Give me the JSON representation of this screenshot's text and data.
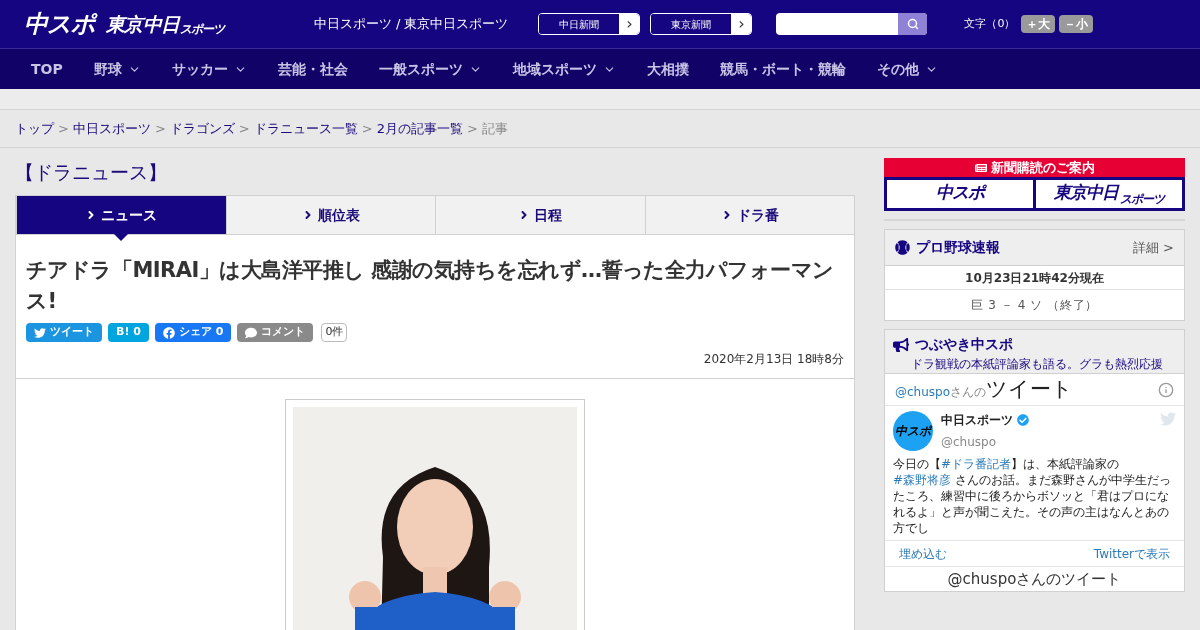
{
  "header": {
    "logo_main": "中スポ",
    "logo_tokyo": "東京中日",
    "logo_tokyo_small": "スポーツ",
    "site_title": "中日スポーツ / 東京中日スポーツ",
    "paper_links": [
      {
        "label": "中日新聞",
        "arrow": "›"
      },
      {
        "label": "東京新聞",
        "arrow": "›"
      }
    ],
    "font_size_label": "文字（0）",
    "font_buttons": [
      "＋大",
      "－小"
    ]
  },
  "nav": [
    {
      "label": "TOP",
      "has_menu": false
    },
    {
      "label": "野球",
      "has_menu": true
    },
    {
      "label": "サッカー",
      "has_menu": true
    },
    {
      "label": "芸能・社会",
      "has_menu": false
    },
    {
      "label": "一般スポーツ",
      "has_menu": true
    },
    {
      "label": "地域スポーツ",
      "has_menu": true
    },
    {
      "label": "大相撲",
      "has_menu": false
    },
    {
      "label": "競馬・ボート・競輪",
      "has_menu": false
    },
    {
      "label": "その他",
      "has_menu": true
    }
  ],
  "breadcrumb": [
    {
      "label": "トップ",
      "link": true
    },
    {
      "label": "中日スポーツ",
      "link": true
    },
    {
      "label": "ドラゴンズ",
      "link": true
    },
    {
      "label": "ドラニュース一覧",
      "link": true
    },
    {
      "label": "2月の記事一覧",
      "link": true
    },
    {
      "label": "記事",
      "link": false
    }
  ],
  "breadcrumb_separator": ">",
  "section_title": "【ドラニュース】",
  "tabs": [
    {
      "label": "ニュース",
      "selected": true
    },
    {
      "label": "順位表",
      "selected": false
    },
    {
      "label": "日程",
      "selected": false
    },
    {
      "label": "ドラ番",
      "selected": false
    }
  ],
  "article": {
    "headline": "チアドラ「MIRAI」は大島洋平推し 感謝の気持ちを忘れず…誓った全力パフォーマンス!",
    "share_buttons": [
      {
        "kind": "twitter",
        "label": "ツイート"
      },
      {
        "kind": "hatena",
        "label": "B! 0"
      },
      {
        "kind": "facebook",
        "label": "シェア 0"
      },
      {
        "kind": "comment",
        "label": "コメント"
      }
    ],
    "comment_count": "0件",
    "date": "2020年2月13日 18時8分"
  },
  "sidebar": {
    "subscribe": {
      "title": "新聞購読のご案内",
      "logos": [
        "中スポ",
        "東京中日"
      ],
      "logo_small": "スポーツ"
    },
    "baseball": {
      "title": "プロ野球速報",
      "detail_link": "詳細 >",
      "updated": "10月23日21時42分現在",
      "score": "巨 3 － 4 ソ （終了）"
    },
    "tweets": {
      "title": "つぶやき中スポ",
      "subtitle": "ドラ観戦の本紙評論家も語る。グラも熱烈応援",
      "handle": "@chuspo",
      "handle_suffix": "さんの",
      "heading": "ツイート",
      "author": "中日スポーツ",
      "author_handle": "@chuspo",
      "avatar_text": "中スポ",
      "verified": true,
      "body": [
        {
          "kind": "text",
          "text": "今日の【"
        },
        {
          "kind": "hashtag",
          "text": "#ドラ番記者"
        },
        {
          "kind": "text",
          "text": "】は、本紙評論家の "
        },
        {
          "kind": "hashtag",
          "text": "#森野将彦"
        },
        {
          "kind": "text",
          "text": " さんのお話。まだ森野さんが中学生だったころ、練習中に後ろからボソッと「君はプロになれるよ」と声が聞こえた。その声の主はなんとあの方でし"
        }
      ],
      "embed_link": "埋め込む",
      "view_link": "Twitterで表示",
      "footer_cut": "@chuspoさんのツイート"
    }
  }
}
